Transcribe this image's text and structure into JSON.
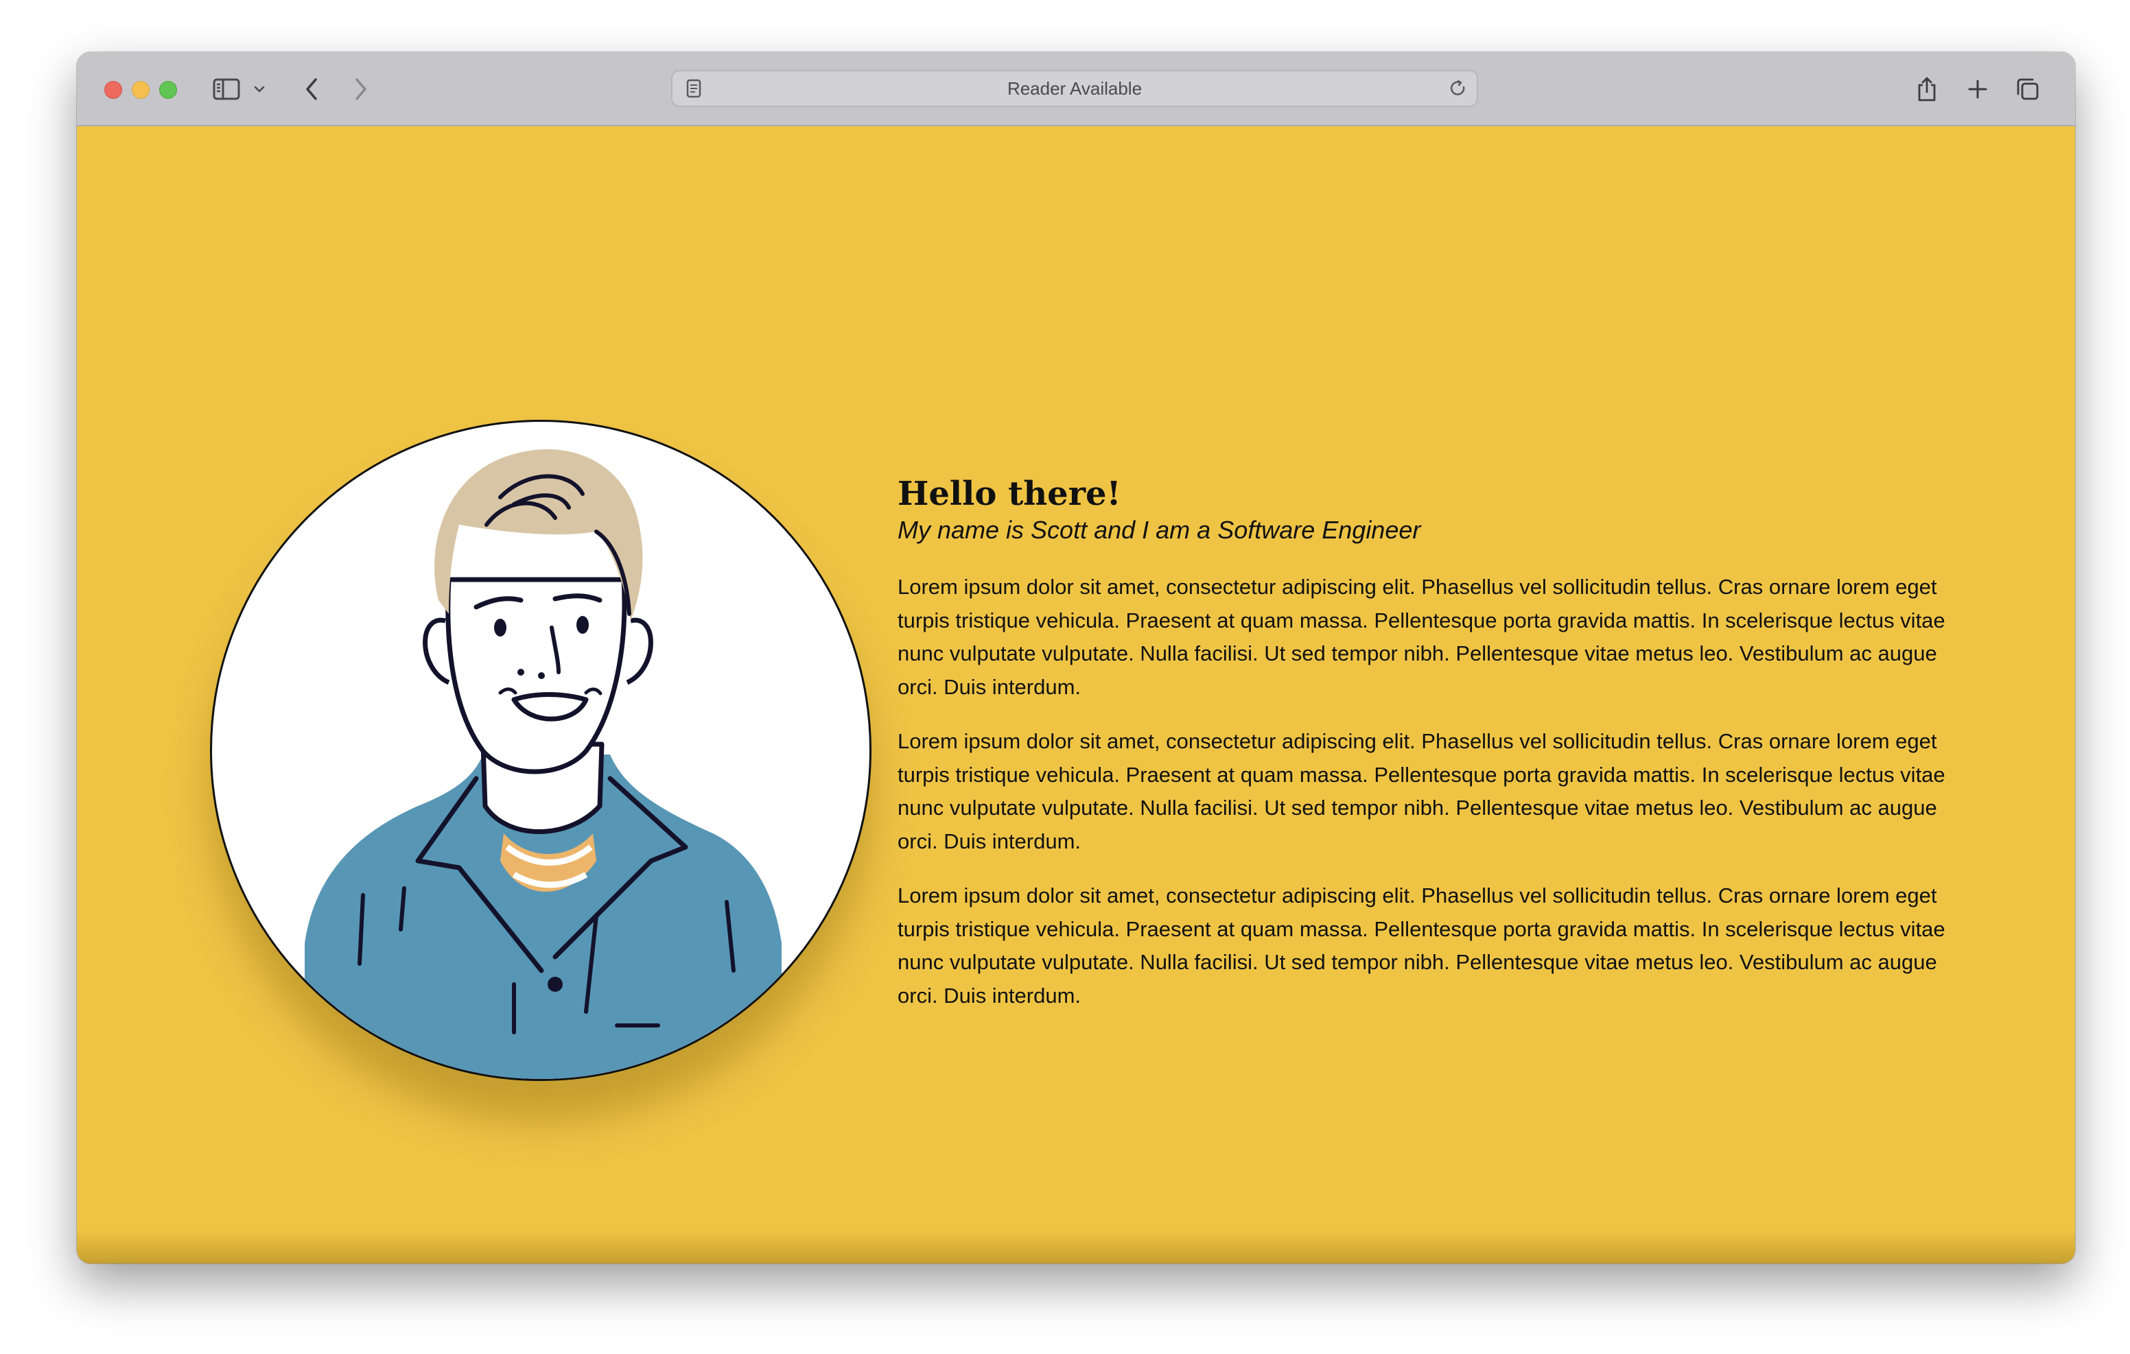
{
  "browser": {
    "address_text": "Reader Available",
    "icons": [
      "sidebar-icon",
      "chevron-down-icon",
      "back-icon",
      "forward-icon",
      "reader-icon",
      "reload-icon",
      "share-icon",
      "plus-icon",
      "tabs-icon"
    ]
  },
  "page": {
    "background_color": "#EFC445",
    "heading": "Hello there!",
    "subheading": "My name is Scott and I am a Software Engineer",
    "paragraphs": [
      "Lorem ipsum dolor sit amet, consectetur adipiscing elit. Phasellus vel sollicitudin tellus. Cras ornare lorem eget turpis tristique vehicula. Praesent at quam massa. Pellentesque porta gravida mattis. In scelerisque lectus vitae nunc vulputate vulputate. Nulla facilisi. Ut sed tempor nibh. Pellentesque vitae metus leo. Vestibulum ac augue orci. Duis interdum.",
      "Lorem ipsum dolor sit amet, consectetur adipiscing elit. Phasellus vel sollicitudin tellus. Cras ornare lorem eget turpis tristique vehicula. Praesent at quam massa. Pellentesque porta gravida mattis. In scelerisque lectus vitae nunc vulputate vulputate. Nulla facilisi. Ut sed tempor nibh. Pellentesque vitae metus leo. Vestibulum ac augue orci. Duis interdum.",
      "Lorem ipsum dolor sit amet, consectetur adipiscing elit. Phasellus vel sollicitudin tellus. Cras ornare lorem eget turpis tristique vehicula. Praesent at quam massa. Pellentesque porta gravida mattis. In scelerisque lectus vitae nunc vulputate vulputate. Nulla facilisi. Ut sed tempor nibh. Pellentesque vitae metus leo. Vestibulum ac augue orci. Duis interdum."
    ]
  }
}
